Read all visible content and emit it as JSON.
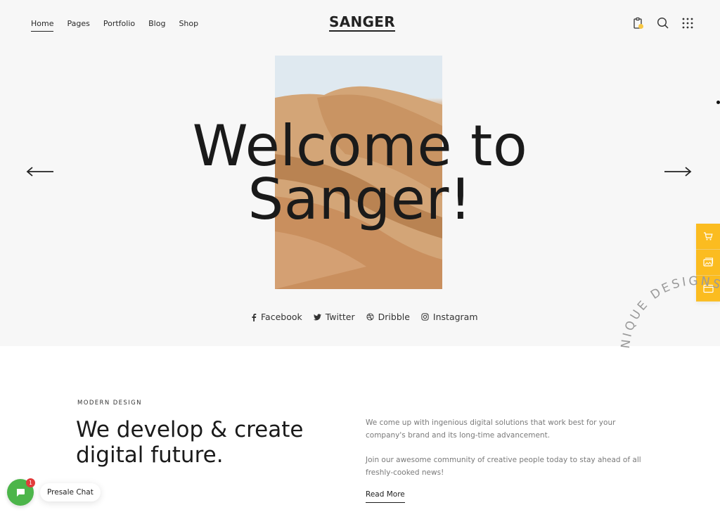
{
  "header": {
    "logo": "SANGER",
    "nav": [
      {
        "label": "Home",
        "active": true
      },
      {
        "label": "Pages",
        "active": false
      },
      {
        "label": "Portfolio",
        "active": false
      },
      {
        "label": "Blog",
        "active": false
      },
      {
        "label": "Shop",
        "active": false
      }
    ],
    "icons": [
      "clipboard-icon",
      "search-icon",
      "grid-menu-icon"
    ],
    "accent_color": "#fbbc20"
  },
  "hero": {
    "title_line1": "Welcome to",
    "title_line2": "Sanger!",
    "image": "desert-dune-image",
    "prev_icon": "arrow-left-icon",
    "next_icon": "arrow-right-icon",
    "social": [
      {
        "label": "Facebook",
        "icon": "facebook-icon"
      },
      {
        "label": "Twitter",
        "icon": "twitter-icon"
      },
      {
        "label": "Dribble",
        "icon": "dribbble-icon"
      },
      {
        "label": "Instagram",
        "icon": "instagram-icon"
      }
    ]
  },
  "side_tools": [
    "cart-icon",
    "image-gallery-icon",
    "browser-window-icon"
  ],
  "circular_text": "UNIQUE DESIGNS AND ... PROJECT.",
  "about": {
    "eyebrow": "MODERN DESIGN",
    "title_line1": "We develop & create",
    "title_line2": "digital future.",
    "paragraph1": "We come up with ingenious digital solutions that work best for your company's brand and its long-time advancement.",
    "paragraph2": "Join our awesome community of creative people today to stay ahead of all freshly-cooked news!",
    "read_more": "Read More"
  },
  "chat": {
    "label": "Presale Chat",
    "badge_count": "1",
    "color": "#4cb54a"
  }
}
